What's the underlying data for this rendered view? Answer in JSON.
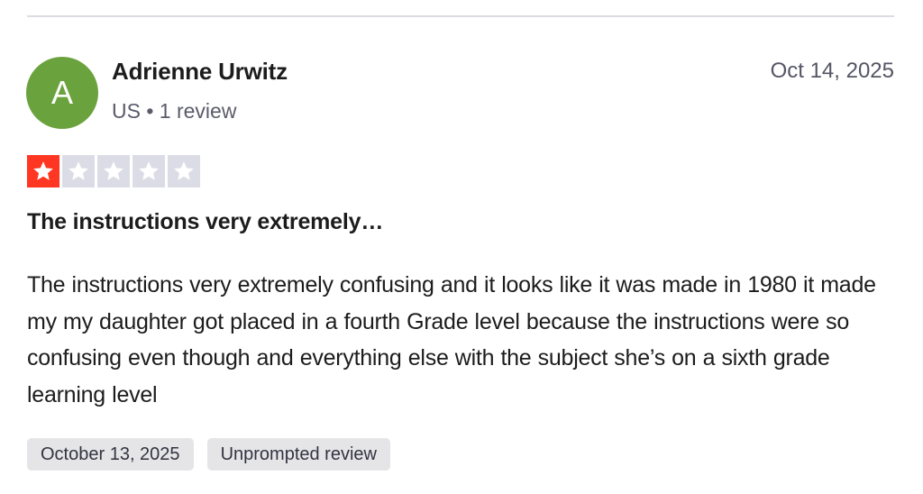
{
  "review": {
    "avatar_initial": "A",
    "reviewer_name": "Adrienne Urwitz",
    "reviewer_meta": "US • 1 review",
    "date": "Oct 14, 2025",
    "rating": 1,
    "rating_max": 5,
    "star_colors": {
      "filled": "#ff3722",
      "empty": "#dcdce6",
      "glyph": "#ffffff"
    },
    "avatar_color": "#6aa33e",
    "headline": "The instructions very extremely…",
    "body": "The instructions very extremely confusing and it looks like it was made in 1980 it made my my daughter got placed in a fourth Grade level because the instructions were so confusing even though and everything else with the subject she’s on a sixth grade learning level",
    "tags": [
      "October 13, 2025",
      "Unprompted review"
    ]
  }
}
